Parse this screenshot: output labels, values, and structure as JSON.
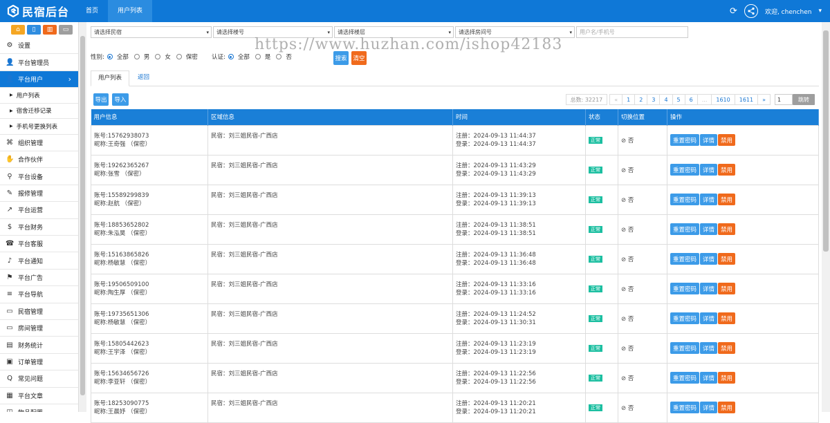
{
  "app": {
    "logo_text": "民宿后台"
  },
  "topnav": {
    "home": "首页",
    "user_list": "用户列表"
  },
  "user": {
    "welcome": "欢迎, chenchen",
    "caret": "▾"
  },
  "sidebar": {
    "items_top": [
      {
        "label": "设置",
        "icon": "gear-icon",
        "glyph": "⚙"
      },
      {
        "label": "平台管理员",
        "icon": "user-plus-icon",
        "glyph": "👤"
      }
    ],
    "active": {
      "label": "平台用户",
      "icon": "user-icon",
      "glyph": "👤"
    },
    "subs": [
      "用户列表",
      "宿舍迁移记录",
      "手机号更换列表"
    ],
    "items_bottom": [
      {
        "label": "组织管理",
        "icon": "sitemap-icon",
        "glyph": "⌘"
      },
      {
        "label": "合作伙伴",
        "icon": "handshake-icon",
        "glyph": "✋"
      },
      {
        "label": "平台设备",
        "icon": "device-icon",
        "glyph": "⚲"
      },
      {
        "label": "报修管理",
        "icon": "wrench-icon",
        "glyph": "✎"
      },
      {
        "label": "平台运营",
        "icon": "chart-icon",
        "glyph": "↗"
      },
      {
        "label": "平台财务",
        "icon": "dollar-icon",
        "glyph": "$"
      },
      {
        "label": "平台客服",
        "icon": "phone-icon",
        "glyph": "☎"
      },
      {
        "label": "平台通知",
        "icon": "bell-icon",
        "glyph": "♪"
      },
      {
        "label": "平台广告",
        "icon": "flag-icon",
        "glyph": "⚑"
      },
      {
        "label": "平台导航",
        "icon": "list-icon",
        "glyph": "≡"
      },
      {
        "label": "民宿管理",
        "icon": "monitor-icon",
        "glyph": "▭"
      },
      {
        "label": "房间管理",
        "icon": "monitor-icon",
        "glyph": "▭"
      },
      {
        "label": "财务统计",
        "icon": "stats-icon",
        "glyph": "▤"
      },
      {
        "label": "订单管理",
        "icon": "order-icon",
        "glyph": "▣"
      },
      {
        "label": "常见问题",
        "icon": "question-icon",
        "glyph": "Q"
      },
      {
        "label": "平台文章",
        "icon": "grid-icon",
        "glyph": "▦"
      },
      {
        "label": "物品配置",
        "icon": "config-icon",
        "glyph": "◫"
      }
    ]
  },
  "filters": {
    "homestay": "请选择民宿",
    "building": "请选择楼号",
    "floor": "请选择楼层",
    "room": "请选择房间号",
    "keyword_placeholder": "用户名/手机号"
  },
  "gender": {
    "label": "性别:",
    "all": "全部",
    "male": "男",
    "female": "女",
    "secret": "保密"
  },
  "verify": {
    "label": "认证:",
    "all": "全部",
    "yes": "是",
    "no": "否"
  },
  "actions": {
    "search": "搜索",
    "clear": "清空",
    "export": "导出",
    "import": "导入"
  },
  "watermark": "https://www.huzhan.com/ishop42183",
  "tabs": {
    "list": "用户列表",
    "back": "返回"
  },
  "pager": {
    "total": "总数: 32217",
    "prev": "«",
    "pages": [
      "1",
      "2",
      "3",
      "4",
      "5",
      "6",
      "...",
      "1610",
      "1611"
    ],
    "next": "»",
    "jump_value": "1",
    "jump": "跳转"
  },
  "table": {
    "headers": [
      "用户信息",
      "区域信息",
      "时间",
      "状态",
      "切换位置",
      "操作"
    ],
    "op_labels": {
      "reset": "重置密码",
      "detail": "详情",
      "disable": "禁用"
    },
    "rows": [
      {
        "account": "账号:15762938073",
        "nick": "昵称:王奇强 （保密）",
        "area": "民宿：刘三姐民宿-广西店",
        "reg": "注册：2024-09-13 11:44:37",
        "login": "登录：2024-09-13 11:44:37",
        "status": "正常",
        "switch": "⊘ 否"
      },
      {
        "account": "账号:19262365267",
        "nick": "昵称:张雪 （保密）",
        "area": "民宿：刘三姐民宿-广西店",
        "reg": "注册：2024-09-13 11:43:29",
        "login": "登录：2024-09-13 11:43:29",
        "status": "正常",
        "switch": "⊘ 否"
      },
      {
        "account": "账号:15589299839",
        "nick": "昵称:赵航 （保密）",
        "area": "民宿：刘三姐民宿-广西店",
        "reg": "注册：2024-09-13 11:39:13",
        "login": "登录：2024-09-13 11:39:13",
        "status": "正常",
        "switch": "⊘ 否"
      },
      {
        "account": "账号:18853652802",
        "nick": "昵称:朱泓昊 （保密）",
        "area": "民宿：刘三姐民宿-广西店",
        "reg": "注册：2024-09-13 11:38:51",
        "login": "登录：2024-09-13 11:38:51",
        "status": "正常",
        "switch": "⊘ 否"
      },
      {
        "account": "账号:15163865826",
        "nick": "昵称:杨敏慧 （保密）",
        "area": "民宿：刘三姐民宿-广西店",
        "reg": "注册：2024-09-13 11:36:48",
        "login": "登录：2024-09-13 11:36:48",
        "status": "正常",
        "switch": "⊘ 否"
      },
      {
        "account": "账号:19506509100",
        "nick": "昵称:陶生厚 （保密）",
        "area": "民宿：刘三姐民宿-广西店",
        "reg": "注册：2024-09-13 11:33:16",
        "login": "登录：2024-09-13 11:33:16",
        "status": "正常",
        "switch": "⊘ 否"
      },
      {
        "account": "账号:19735651306",
        "nick": "昵称:杨敏慧 （保密）",
        "area": "民宿：刘三姐民宿-广西店",
        "reg": "注册：2024-09-13 11:24:52",
        "login": "登录：2024-09-13 11:30:31",
        "status": "正常",
        "switch": "⊘ 否"
      },
      {
        "account": "账号:15805442623",
        "nick": "昵称:王宇泽 （保密）",
        "area": "民宿：刘三姐民宿-广西店",
        "reg": "注册：2024-09-13 11:23:19",
        "login": "登录：2024-09-13 11:23:19",
        "status": "正常",
        "switch": "⊘ 否"
      },
      {
        "account": "账号:15634656726",
        "nick": "昵称:李亚轩 （保密）",
        "area": "民宿：刘三姐民宿-广西店",
        "reg": "注册：2024-09-13 11:22:56",
        "login": "登录：2024-09-13 11:22:56",
        "status": "正常",
        "switch": "⊘ 否"
      },
      {
        "account": "账号:18253090775",
        "nick": "昵称:王晨妤 （保密）",
        "area": "民宿：刘三姐民宿-广西店",
        "reg": "注册：2024-09-13 11:20:21",
        "login": "登录：2024-09-13 11:20:21",
        "status": "正常",
        "switch": "⊘ 否"
      }
    ]
  },
  "colors": {
    "primary": "#0f78d7",
    "op_blue": "#3c9be8",
    "op_orange": "#f06a1c",
    "status": "#1cbfa1",
    "search": "#3c9be8",
    "clear": "#f06a1c"
  }
}
